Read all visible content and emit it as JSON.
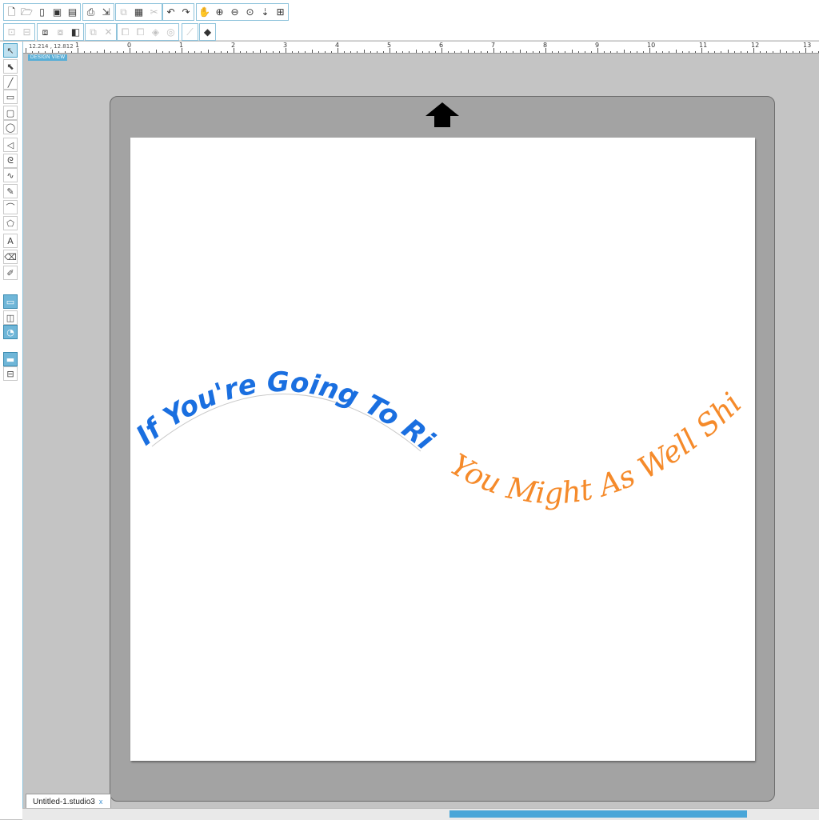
{
  "toolbar": {
    "row1": [
      {
        "name": "new-document-icon",
        "glyph": "🗋"
      },
      {
        "name": "open-icon",
        "glyph": "🗁"
      },
      {
        "name": "open-library-icon",
        "glyph": "▯"
      },
      {
        "name": "save-icon",
        "glyph": "▣"
      },
      {
        "name": "save-as-icon",
        "glyph": "▤"
      },
      {
        "name": "print-icon",
        "glyph": "⎙"
      },
      {
        "name": "send-to-cutter-icon",
        "glyph": "⇲"
      },
      {
        "name": "copy-icon",
        "glyph": "⧉",
        "disabled": true
      },
      {
        "name": "paste-icon",
        "glyph": "▦"
      },
      {
        "name": "cut-icon",
        "glyph": "✂",
        "disabled": true
      },
      {
        "name": "undo-icon",
        "glyph": "↶"
      },
      {
        "name": "redo-icon",
        "glyph": "↷"
      },
      {
        "name": "pan-hand-icon",
        "glyph": "✋"
      },
      {
        "name": "zoom-in-icon",
        "glyph": "⊕"
      },
      {
        "name": "zoom-out-icon",
        "glyph": "⊖"
      },
      {
        "name": "zoom-select-icon",
        "glyph": "⊙"
      },
      {
        "name": "drag-zoom-icon",
        "glyph": "⇣"
      },
      {
        "name": "fit-to-page-icon",
        "glyph": "⊞"
      }
    ],
    "row2": [
      {
        "name": "group-icon",
        "glyph": "⊡",
        "disabled": true
      },
      {
        "name": "ungroup-icon",
        "glyph": "⊟",
        "disabled": true
      },
      {
        "name": "make-compound-icon",
        "glyph": "⧈"
      },
      {
        "name": "release-compound-icon",
        "glyph": "⧇",
        "disabled": true
      },
      {
        "name": "bring-forward-icon",
        "glyph": "◧"
      },
      {
        "name": "weld-icon",
        "glyph": "⧉",
        "disabled": true
      },
      {
        "name": "delete-icon",
        "glyph": "✕",
        "disabled": true
      },
      {
        "name": "align-left-icon",
        "glyph": "⧠",
        "disabled": true
      },
      {
        "name": "align-right-icon",
        "glyph": "⧠",
        "disabled": true
      },
      {
        "name": "trace-icon",
        "glyph": "◈",
        "disabled": true
      },
      {
        "name": "offset-icon",
        "glyph": "◎",
        "disabled": true
      },
      {
        "name": "knife-icon",
        "glyph": "⟋",
        "disabled": true
      },
      {
        "name": "layers-icon",
        "glyph": "◆"
      }
    ]
  },
  "ruler": {
    "coords": "12.214 , 12.812",
    "numbers": [
      "1",
      "0",
      "1",
      "2",
      "3",
      "4",
      "5",
      "6",
      "7",
      "8",
      "9",
      "10",
      "11",
      "12",
      "13"
    ]
  },
  "left_tools": [
    {
      "name": "select-tool-icon",
      "glyph": "↖",
      "active": true
    },
    {
      "name": "point-edit-tool-icon",
      "glyph": "⬉"
    },
    {
      "name": "line-tool-icon",
      "glyph": "╱"
    },
    {
      "name": "rectangle-tool-icon",
      "glyph": "▭"
    },
    {
      "name": "rounded-rectangle-tool-icon",
      "glyph": "▢"
    },
    {
      "name": "ellipse-tool-icon",
      "glyph": "◯"
    },
    {
      "name": "polygon-tool-icon",
      "glyph": "◁"
    },
    {
      "name": "curve-tool-icon",
      "glyph": "ᘓ"
    },
    {
      "name": "freehand-tool-icon",
      "glyph": "∿"
    },
    {
      "name": "smooth-freehand-tool-icon",
      "glyph": "✎"
    },
    {
      "name": "arc-tool-icon",
      "glyph": "⌒"
    },
    {
      "name": "regular-polygon-tool-icon",
      "glyph": "⬠"
    },
    {
      "name": "text-tool-icon",
      "glyph": "A"
    },
    {
      "name": "eraser-tool-icon",
      "glyph": "⌫"
    },
    {
      "name": "knife-tool-icon",
      "glyph": "✐"
    },
    {
      "name": "page-setup-panel-icon",
      "glyph": "▭",
      "blue": true
    },
    {
      "name": "library-panel-icon",
      "glyph": "◫"
    },
    {
      "name": "design-store-icon",
      "glyph": "◔",
      "blue": true
    },
    {
      "name": "design-view-icon",
      "glyph": "▬",
      "blue": true
    },
    {
      "name": "split-view-icon",
      "glyph": "⊟"
    }
  ],
  "design_view_label": "DESIGN VIEW",
  "canvas": {
    "text_upper": "If You're Going To Rise",
    "text_lower": "You Might As Well Shine",
    "color_upper": "#1a6fe0",
    "color_lower": "#f58a2a"
  },
  "document_tab": {
    "label": "Untitled-1.studio3",
    "close": "x"
  }
}
